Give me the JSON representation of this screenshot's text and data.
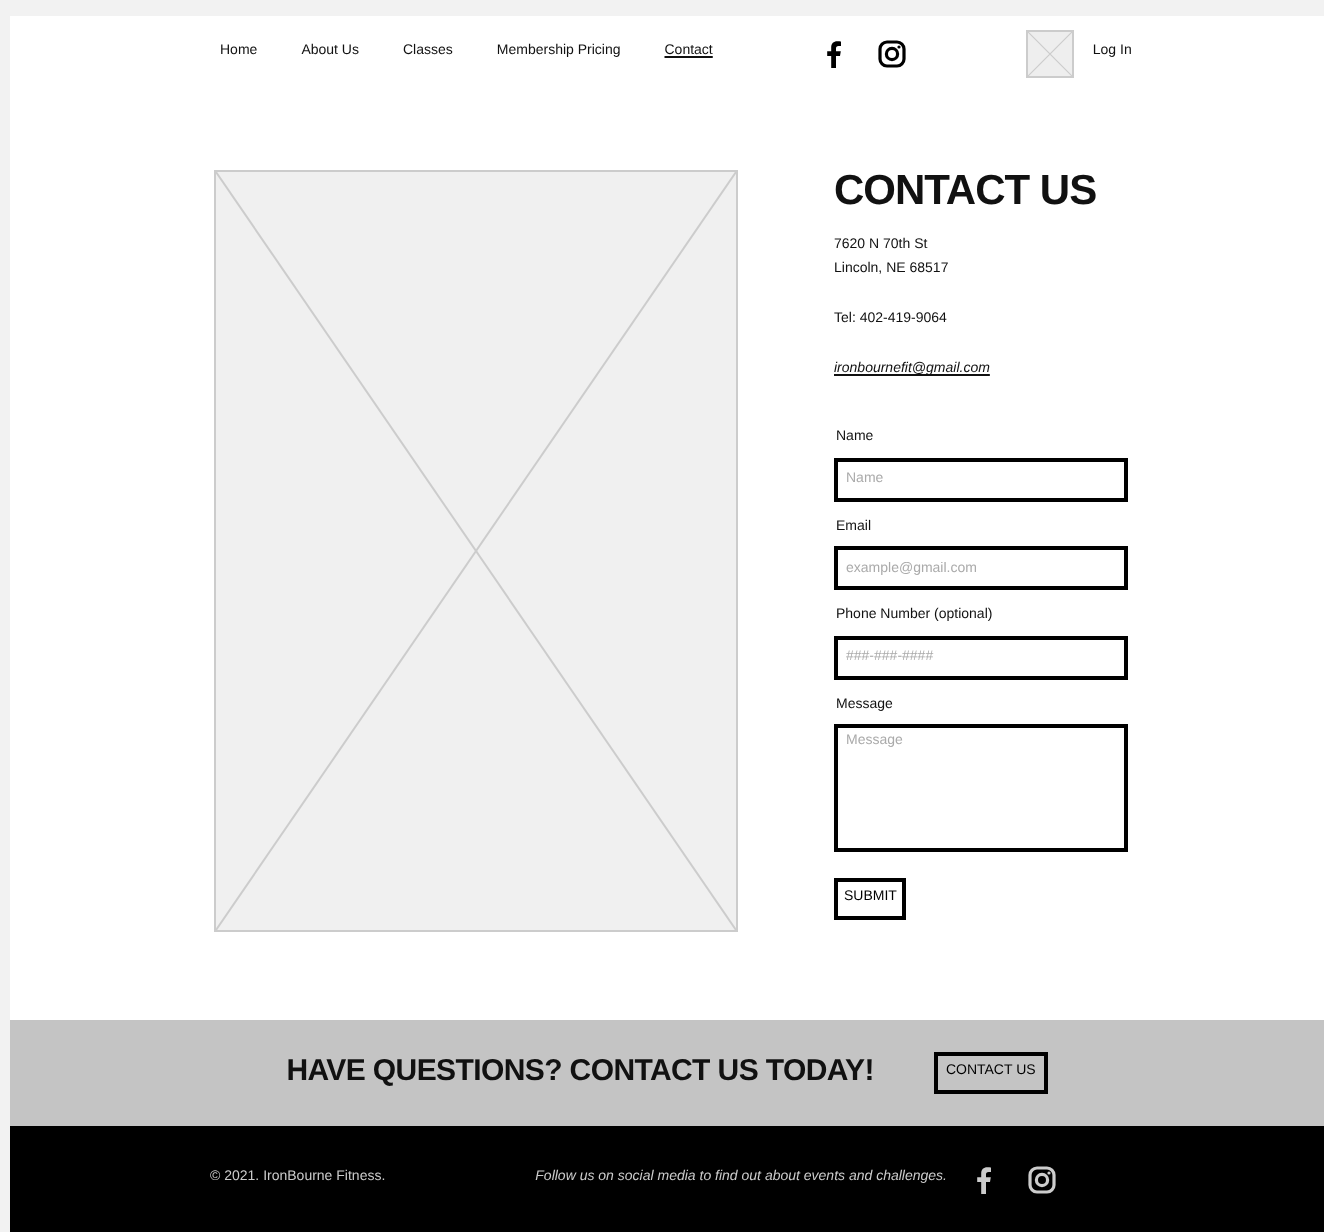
{
  "nav": [
    {
      "label": "Home",
      "selected": false
    },
    {
      "label": "About Us",
      "selected": false
    },
    {
      "label": "Classes",
      "selected": false
    },
    {
      "label": "Membership Pricing",
      "selected": false
    },
    {
      "label": "Contact",
      "selected": true
    }
  ],
  "login": "Log In",
  "contact": {
    "title": "CONTACT US",
    "address": [
      "7620 N 70th St",
      "Lincoln, NE 68517"
    ],
    "phone": "Tel: 402-419-9064",
    "email": "ironbournefit@gmail.com"
  },
  "form": {
    "fields": [
      {
        "label": "Name",
        "placeholder": "Name",
        "kind": "input"
      },
      {
        "label": "Email",
        "placeholder": "example@gmail.com",
        "kind": "input"
      },
      {
        "label": "Phone Number (optional)",
        "placeholder": "###-###-####",
        "kind": "input"
      },
      {
        "label": "Message",
        "placeholder": "Message",
        "kind": "textarea"
      }
    ],
    "submit": "SUBMIT"
  },
  "banner": {
    "text": "HAVE QUESTIONS? CONTACT US TODAY!",
    "button": "CONTACT US"
  },
  "footer": {
    "copyright": "© 2021. IronBourne Fitness.",
    "social_text": "Follow us on social media to find out about events and challenges."
  }
}
